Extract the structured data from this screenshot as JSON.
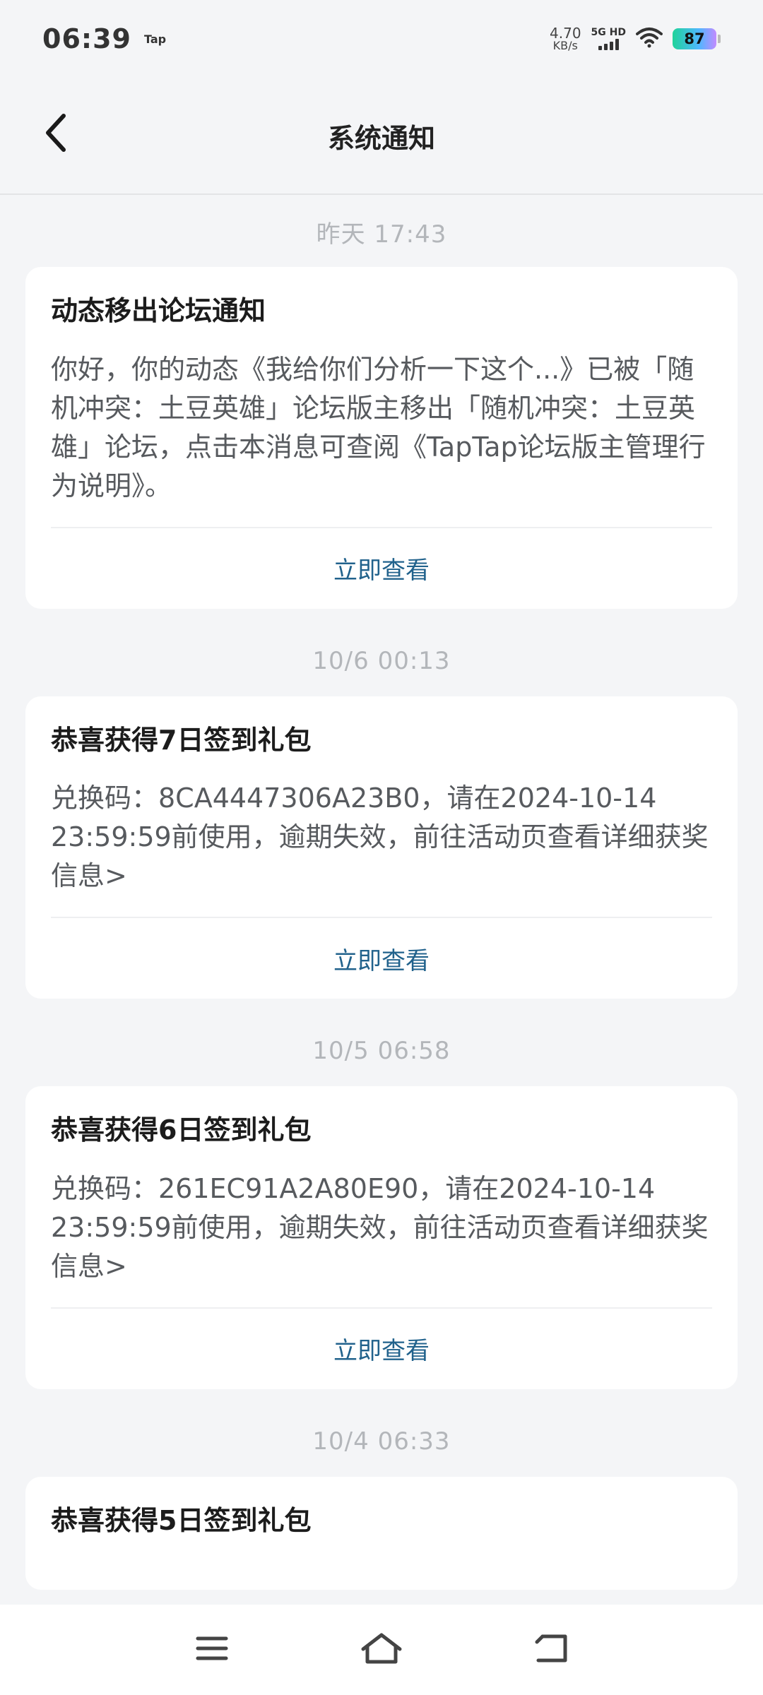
{
  "status_bar": {
    "time": "06:39",
    "app_badge": "Tap",
    "net_speed_value": "4.70",
    "net_speed_unit": "KB/s",
    "signal_label": "5G HD",
    "battery_level": "87"
  },
  "header": {
    "title": "系统通知"
  },
  "notifications": [
    {
      "time": "昨天  17:43",
      "title": "动态移出论坛通知",
      "body": "你好，你的动态《我给你们分析一下这个...》已被「随机冲突：土豆英雄」论坛版主移出「随机冲突：土豆英雄」论坛，点击本消息可查阅《TapTap论坛版主管理行为说明》。",
      "action": "立即查看"
    },
    {
      "time": "10/6  00:13",
      "title": "恭喜获得7日签到礼包",
      "body": "兑换码：8CA4447306A23B0，请在2024-10-14 23:59:59前使用，逾期失效，前往活动页查看详细获奖信息>",
      "action": "立即查看"
    },
    {
      "time": "10/5  06:58",
      "title": "恭喜获得6日签到礼包",
      "body": "兑换码：261EC91A2A80E90，请在2024-10-14 23:59:59前使用，逾期失效，前往活动页查看详细获奖信息>",
      "action": "立即查看"
    },
    {
      "time": "10/4  06:33",
      "title": "恭喜获得5日签到礼包"
    }
  ],
  "icons": {
    "back": "back-arrow-icon",
    "menu": "menu-icon",
    "home": "home-icon",
    "return": "return-icon"
  }
}
